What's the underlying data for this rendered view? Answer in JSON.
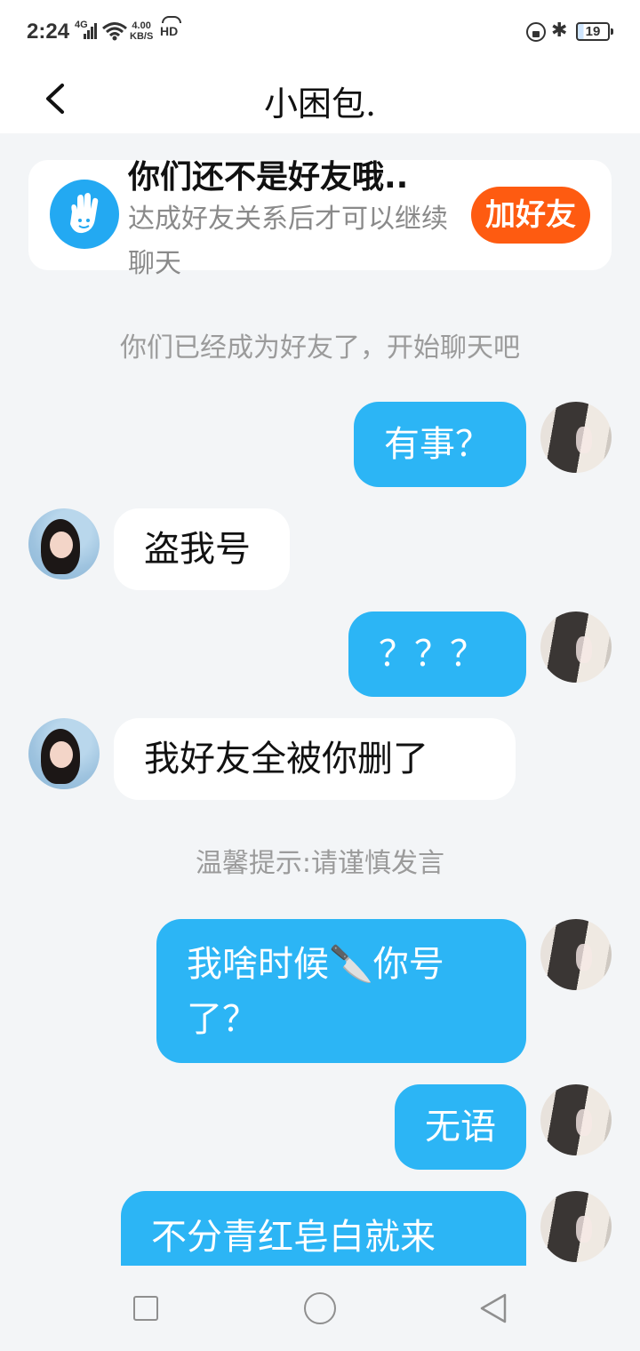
{
  "status_bar": {
    "time": "2:24",
    "network": "4G",
    "speed_value": "4.00",
    "speed_unit": "KB/S",
    "hd": "HD",
    "battery": "19"
  },
  "header": {
    "title": "小困包."
  },
  "friend_notice": {
    "title": "你们还不是好友哦..",
    "description": "达成好友关系后才可以继续聊天",
    "add_button": "加好友"
  },
  "system_tips": {
    "became_friends": "你们已经成为好友了，开始聊天吧",
    "warning": "温馨提示:请谨慎发言"
  },
  "messages": [
    {
      "direction": "out",
      "text": "有事？"
    },
    {
      "direction": "in",
      "text": "盗我号"
    },
    {
      "direction": "out",
      "text": "？？？"
    },
    {
      "direction": "in",
      "text": "我好友全被你删了"
    },
    {
      "direction": "out",
      "text": "我啥时候🔪你号了？"
    },
    {
      "direction": "out",
      "text": "无语"
    },
    {
      "direction": "out",
      "text": "不分青红皂白就来"
    }
  ],
  "icons": {
    "back": "chevron-left-icon",
    "hand": "hand-wave-icon",
    "nav_recent": "square-icon",
    "nav_home": "circle-icon",
    "nav_back": "triangle-back-icon"
  },
  "colors": {
    "outgoing_bubble": "#2cb5f5",
    "incoming_bubble": "#ffffff",
    "add_friend_button": "#fe5b11",
    "background": "#f3f5f7"
  }
}
